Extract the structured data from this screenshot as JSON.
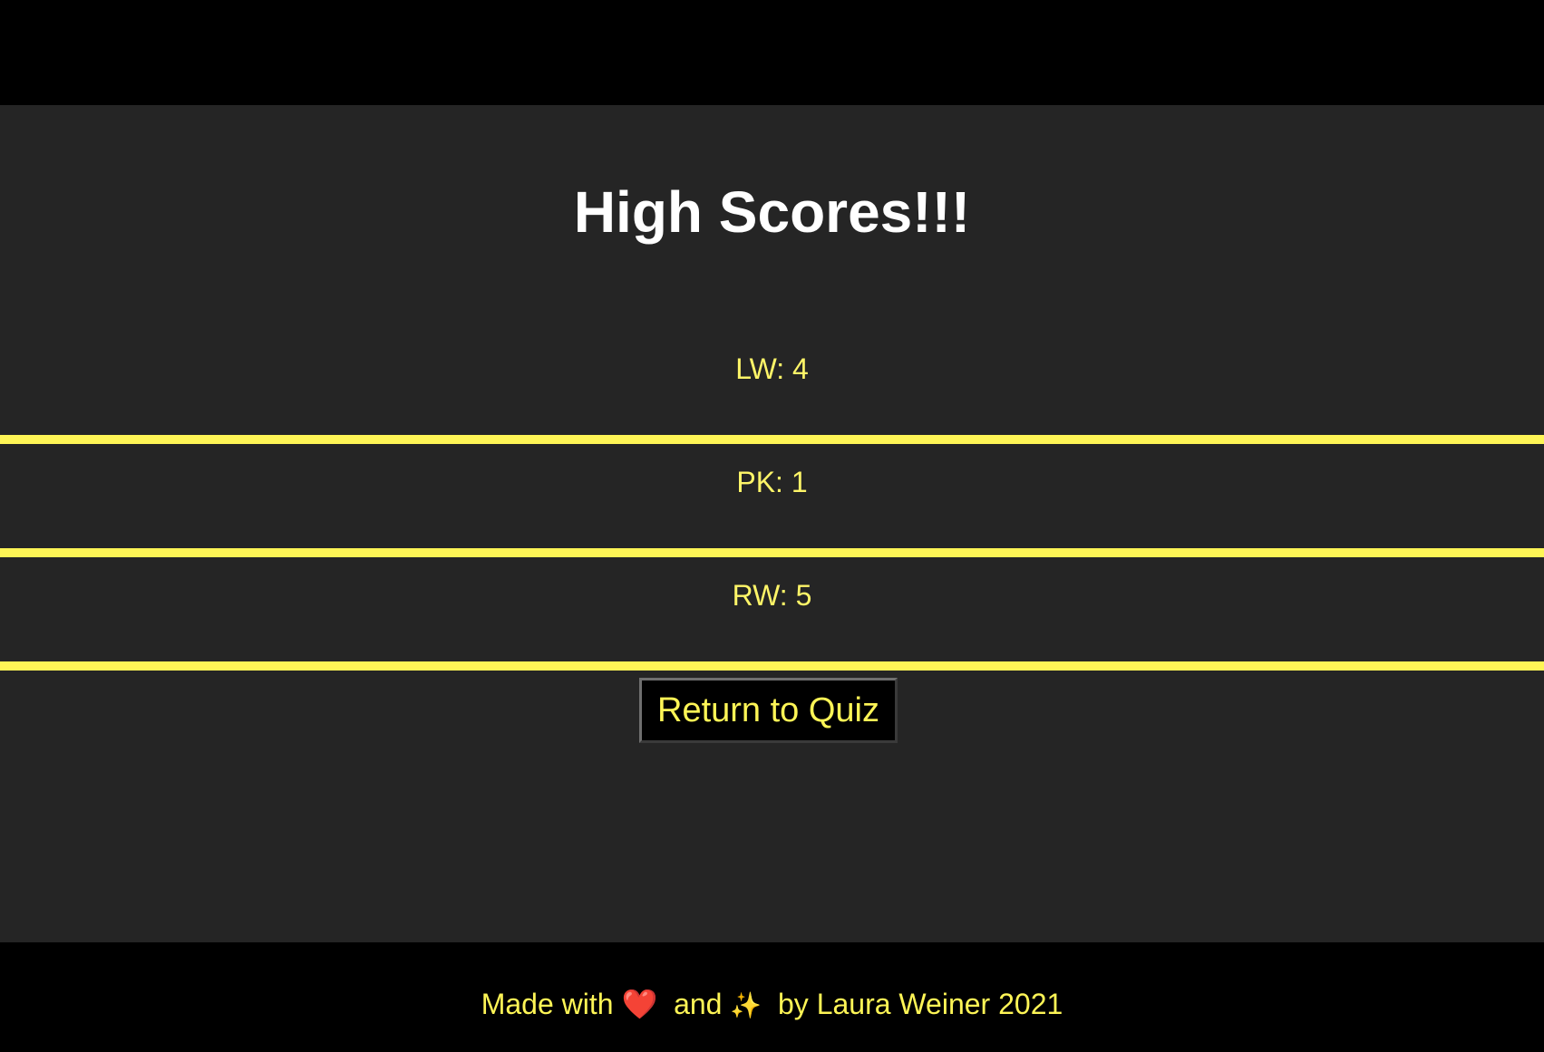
{
  "page": {
    "title": "High Scores!!!"
  },
  "scores": [
    {
      "text": "LW: 4"
    },
    {
      "text": "PK: 1"
    },
    {
      "text": "RW: 5"
    }
  ],
  "actions": {
    "return_label": "Return to Quiz"
  },
  "footer": {
    "made_with": "Made with",
    "heart_icon": "❤️",
    "and": "and",
    "sparkles_icon": "✨",
    "by": "by Laura Weiner 2021"
  },
  "colors": {
    "background": "#252525",
    "bars": "#000000",
    "accent": "#fef556",
    "title": "#ffffff"
  }
}
